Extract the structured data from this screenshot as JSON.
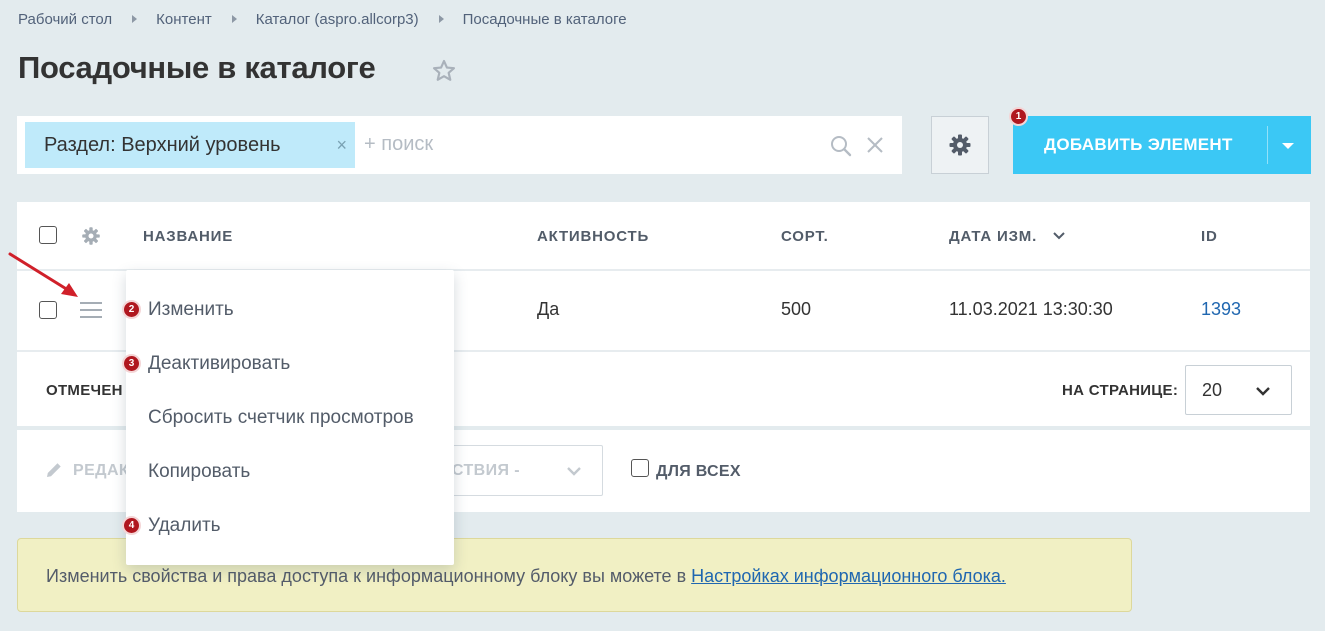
{
  "breadcrumb": [
    "Рабочий стол",
    "Контент",
    "Каталог (aspro.allcorp3)",
    "Посадочные в каталоге"
  ],
  "page_title": "Посадочные в каталоге",
  "filter": {
    "chip_label": "Раздел: Верхний уровень",
    "chip_close": "×",
    "search_placeholder": "+ поиск"
  },
  "add_button": {
    "label": "ДОБАВИТЬ ЭЛЕМЕНТ"
  },
  "badges": [
    "1",
    "2",
    "3",
    "4"
  ],
  "table": {
    "columns": [
      "НАЗВАНИЕ",
      "АКТИВНОСТЬ",
      "СОРТ.",
      "ДАТА ИЗМ.",
      "ID"
    ],
    "rows": [
      {
        "active": "Да",
        "sort": "500",
        "date": "11.03.2021 13:30:30",
        "id": "1393"
      }
    ],
    "footer": {
      "selected_label": "ОТМЕЧЕН",
      "per_page_label": "НА СТРАНИЦЕ:",
      "per_page_value": "20"
    }
  },
  "actions": {
    "edit_label": "РЕДАК",
    "action_select_label": "ЙСТВИЯ -",
    "for_all_label": "ДЛЯ ВСЕХ"
  },
  "context_menu": {
    "items": [
      "Изменить",
      "Деактивировать",
      "Сбросить счетчик просмотров",
      "Копировать",
      "Удалить"
    ]
  },
  "notice": {
    "text": "Изменить свойства и права доступа к информационному блоку вы можете в ",
    "link": "Настройках информационного блока."
  },
  "colors": {
    "accent": "#3bc8f5",
    "badge": "#b0171f",
    "link": "#2067b0",
    "arrow": "#d0202a"
  },
  "icons": [
    "star-icon",
    "search-icon",
    "close-icon",
    "gear-icon",
    "chevron-down-icon",
    "hamburger-icon",
    "pencil-icon",
    "arrow-icon"
  ]
}
